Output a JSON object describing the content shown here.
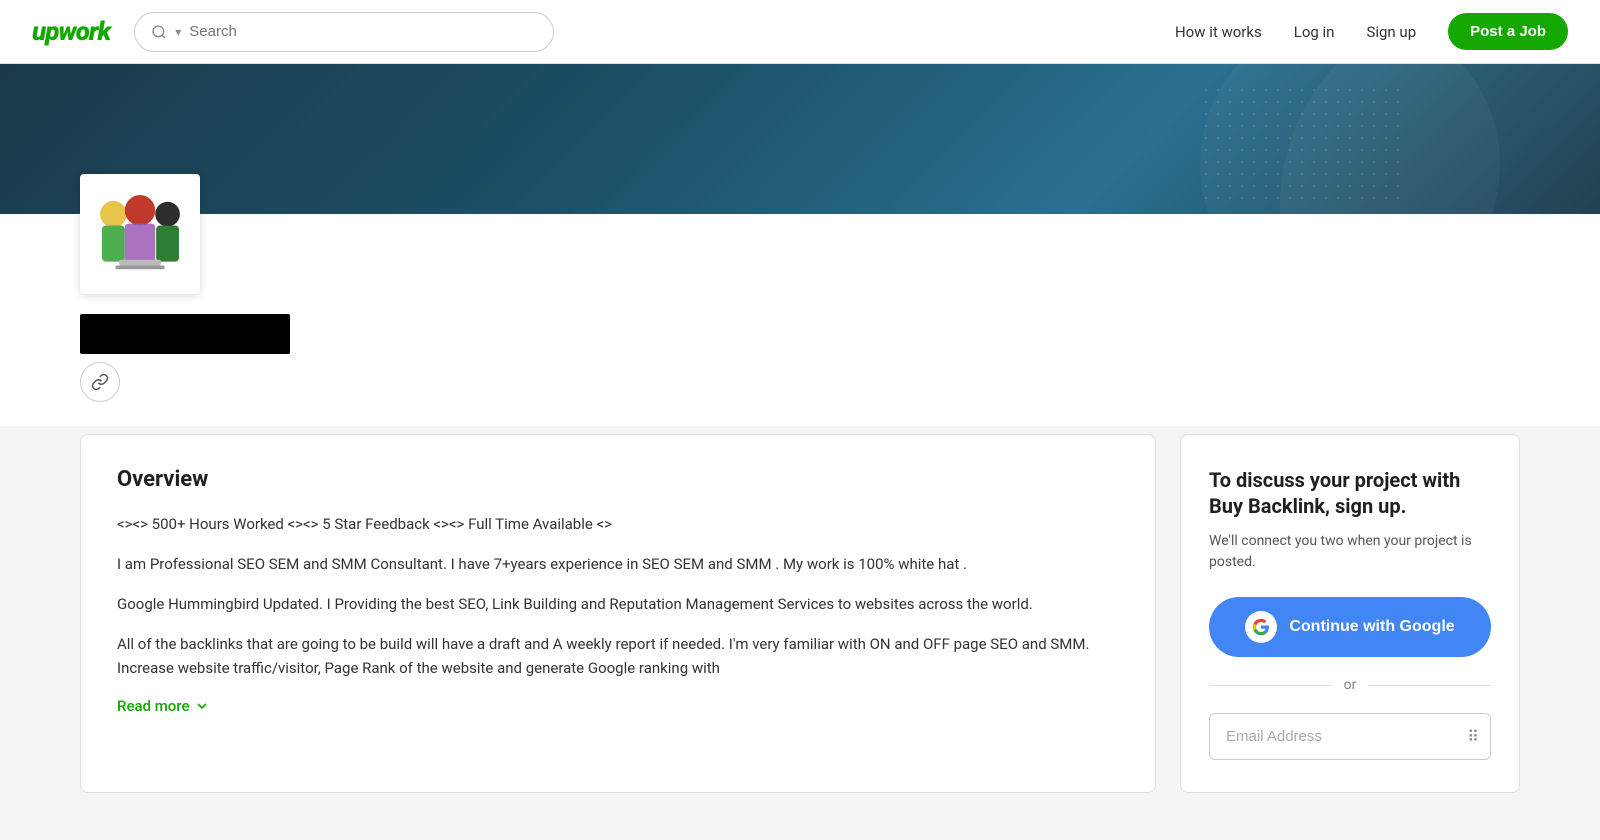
{
  "header": {
    "logo": "upwork",
    "search_placeholder": "Search",
    "nav": {
      "how_it_works": "How it works",
      "login": "Log in",
      "signup": "Sign up",
      "post_job": "Post a Job"
    }
  },
  "profile": {
    "name_bar_hidden": true,
    "link_icon": "🔗"
  },
  "overview": {
    "title": "Overview",
    "paragraphs": [
      "<><> 500+ Hours Worked <><> 5 Star Feedback <><> Full Time Available <>",
      "I am Professional SEO SEM and SMM Consultant. I have 7+years experience in SEO SEM and SMM . My work is 100% white hat .",
      "Google Hummingbird Updated. I Providing the best SEO, Link Building and Reputation Management Services to websites across the world.",
      "All of the backlinks that are going to be build will have a draft and A weekly report if needed. I'm very familiar with ON and OFF page SEO and SMM. Increase website traffic/visitor, Page Rank of the website and generate Google ranking with"
    ],
    "read_more": "Read more"
  },
  "signup_card": {
    "title": "To discuss your project with Buy Backlink, sign up.",
    "subtitle": "We'll connect you two when your project is posted.",
    "google_button": "Continue with Google",
    "or_text": "or",
    "email_placeholder": "Email Address"
  }
}
